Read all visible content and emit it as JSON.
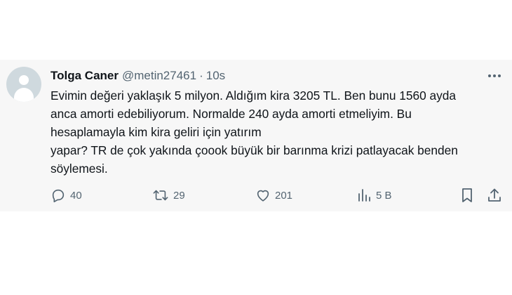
{
  "tweet": {
    "display_name": "Tolga Caner",
    "handle": "@metin27461",
    "separator": "·",
    "timestamp": "10s",
    "text_lines": [
      "Evimin değeri yaklaşık 5 milyon. Aldığım kira 3205 TL. Ben bunu 1560 ayda",
      "anca amorti edebiliyorum. Normalde 240 ayda amorti etmeliyim. Bu",
      "hesaplamayla kim kira geliri için yatırım",
      "yapar? TR de çok yakında çoook büyük bir barınma krizi patlayacak benden",
      "söylemesi."
    ]
  },
  "actions": {
    "replies": {
      "count": "40",
      "icon": "reply-icon"
    },
    "retweets": {
      "count": "29",
      "icon": "retweet-icon"
    },
    "likes": {
      "count": "201",
      "icon": "heart-icon"
    },
    "views": {
      "count": "5 B",
      "icon": "views-icon"
    },
    "bookmark": {
      "icon": "bookmark-icon"
    },
    "share": {
      "icon": "share-icon"
    }
  },
  "colors": {
    "text_primary": "#0f1419",
    "text_secondary": "#536471",
    "card_background": "#f7f7f7",
    "avatar_background": "#cfd9de"
  }
}
